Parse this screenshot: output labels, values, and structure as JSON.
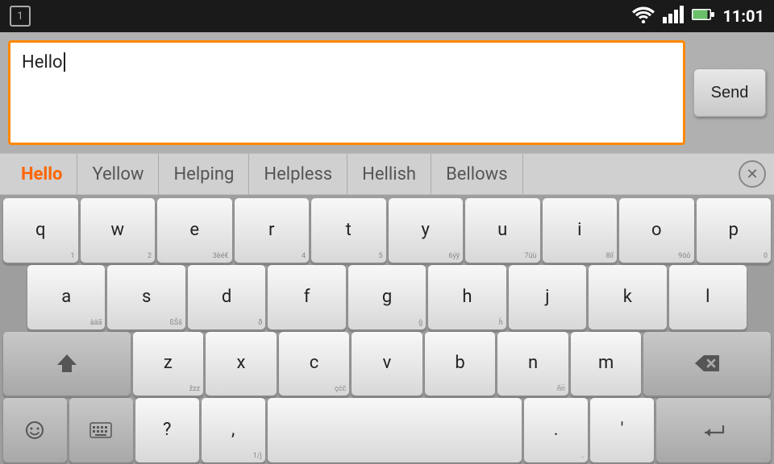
{
  "statusBar": {
    "time": "11:01",
    "notificationNum": "1"
  },
  "inputArea": {
    "text": "Hello",
    "sendLabel": "Send"
  },
  "suggestions": {
    "items": [
      "Hello",
      "Yellow",
      "Helping",
      "Helpless",
      "Hellish",
      "Bellows"
    ]
  },
  "keyboard": {
    "row1": [
      {
        "main": "q",
        "sub": "1"
      },
      {
        "main": "w",
        "sub": "2"
      },
      {
        "main": "e",
        "sub": "3èé€"
      },
      {
        "main": "r",
        "sub": "4"
      },
      {
        "main": "t",
        "sub": "5"
      },
      {
        "main": "y",
        "sub": "6ýÿ"
      },
      {
        "main": "u",
        "sub": "7üù"
      },
      {
        "main": "i",
        "sub": "8ïî"
      },
      {
        "main": "o",
        "sub": "9öô"
      },
      {
        "main": "p",
        "sub": "0"
      }
    ],
    "row2": [
      {
        "main": "a",
        "sub": "àäã"
      },
      {
        "main": "s",
        "sub": "ßŠš"
      },
      {
        "main": "d",
        "sub": "ð"
      },
      {
        "main": "f",
        "sub": ""
      },
      {
        "main": "g",
        "sub": "ĝ"
      },
      {
        "main": "h",
        "sub": "ĥ"
      },
      {
        "main": "j",
        "sub": ""
      },
      {
        "main": "k",
        "sub": ""
      },
      {
        "main": "l",
        "sub": ""
      }
    ],
    "row3": [
      {
        "main": "shift",
        "sub": ""
      },
      {
        "main": "z",
        "sub": "žzz"
      },
      {
        "main": "x",
        "sub": ""
      },
      {
        "main": "c",
        "sub": "çćĉ"
      },
      {
        "main": "v",
        "sub": ""
      },
      {
        "main": "b",
        "sub": ""
      },
      {
        "main": "n",
        "sub": "ñn̈"
      },
      {
        "main": "m",
        "sub": ""
      },
      {
        "main": "backspace",
        "sub": ""
      }
    ],
    "row4": [
      {
        "main": "emoji",
        "sub": "..."
      },
      {
        "main": "keyboard",
        "sub": ""
      },
      {
        "main": "?",
        "sub": ""
      },
      {
        "main": ",",
        "sub": "1/j"
      },
      {
        "main": "space",
        "sub": ""
      },
      {
        "main": ".",
        "sub": ".."
      },
      {
        "main": "'",
        "sub": ""
      },
      {
        "main": "enter",
        "sub": "..."
      }
    ]
  }
}
